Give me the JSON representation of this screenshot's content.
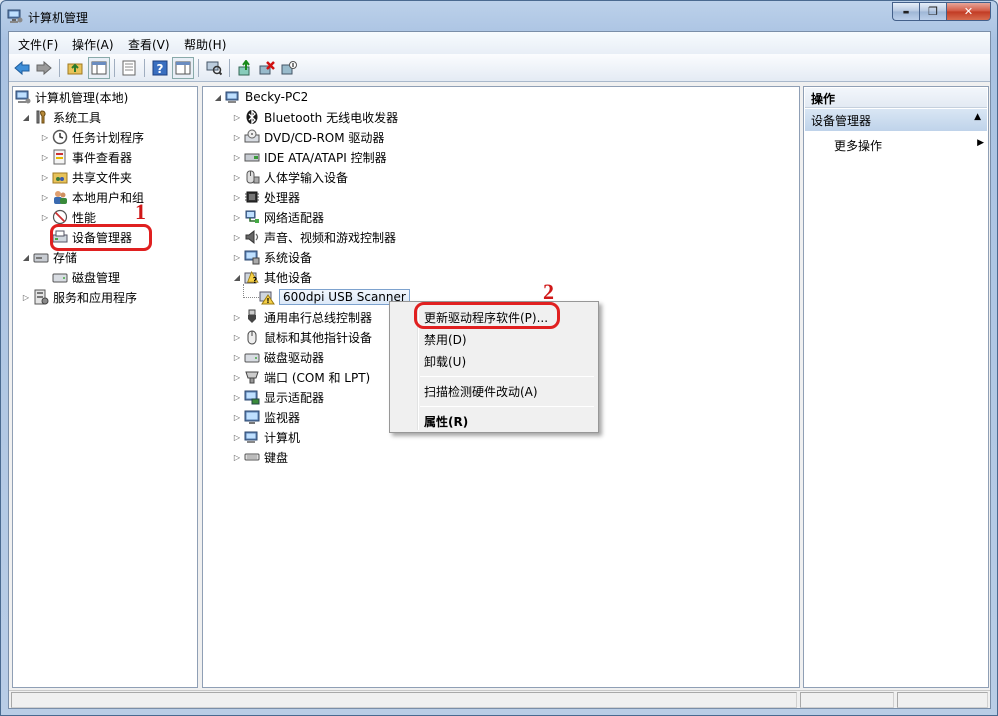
{
  "window": {
    "title": "计算机管理",
    "controls": {
      "minimize": "▬",
      "maximize": "❐",
      "close": "✕"
    }
  },
  "menu": [
    "文件(F)",
    "操作(A)",
    "查看(V)",
    "帮助(H)"
  ],
  "left_tree": {
    "root": "计算机管理(本地)",
    "system_tools": "系统工具",
    "task_scheduler": "任务计划程序",
    "event_viewer": "事件查看器",
    "shared_folders": "共享文件夹",
    "local_users": "本地用户和组",
    "performance": "性能",
    "device_manager": "设备管理器",
    "storage": "存储",
    "disk_management": "磁盘管理",
    "services_apps": "服务和应用程序"
  },
  "annotations": {
    "step1": "1",
    "step2": "2"
  },
  "device_tree": {
    "root": "Becky-PC2",
    "items": [
      "Bluetooth 无线电收发器",
      "DVD/CD-ROM 驱动器",
      "IDE ATA/ATAPI 控制器",
      "人体学输入设备",
      "处理器",
      "网络适配器",
      "声音、视频和游戏控制器",
      "系统设备",
      "其他设备",
      "600dpi USB Scanner",
      "通用串行总线控制器",
      "鼠标和其他指针设备",
      "磁盘驱动器",
      "端口 (COM 和 LPT)",
      "显示适配器",
      "监视器",
      "计算机",
      "键盘"
    ]
  },
  "context_menu": {
    "update_driver": "更新驱动程序软件(P)...",
    "disable": "禁用(D)",
    "uninstall": "卸载(U)",
    "scan": "扫描检测硬件改动(A)",
    "properties": "属性(R)"
  },
  "actions": {
    "header": "操作",
    "section": "设备管理器",
    "more": "更多操作"
  }
}
